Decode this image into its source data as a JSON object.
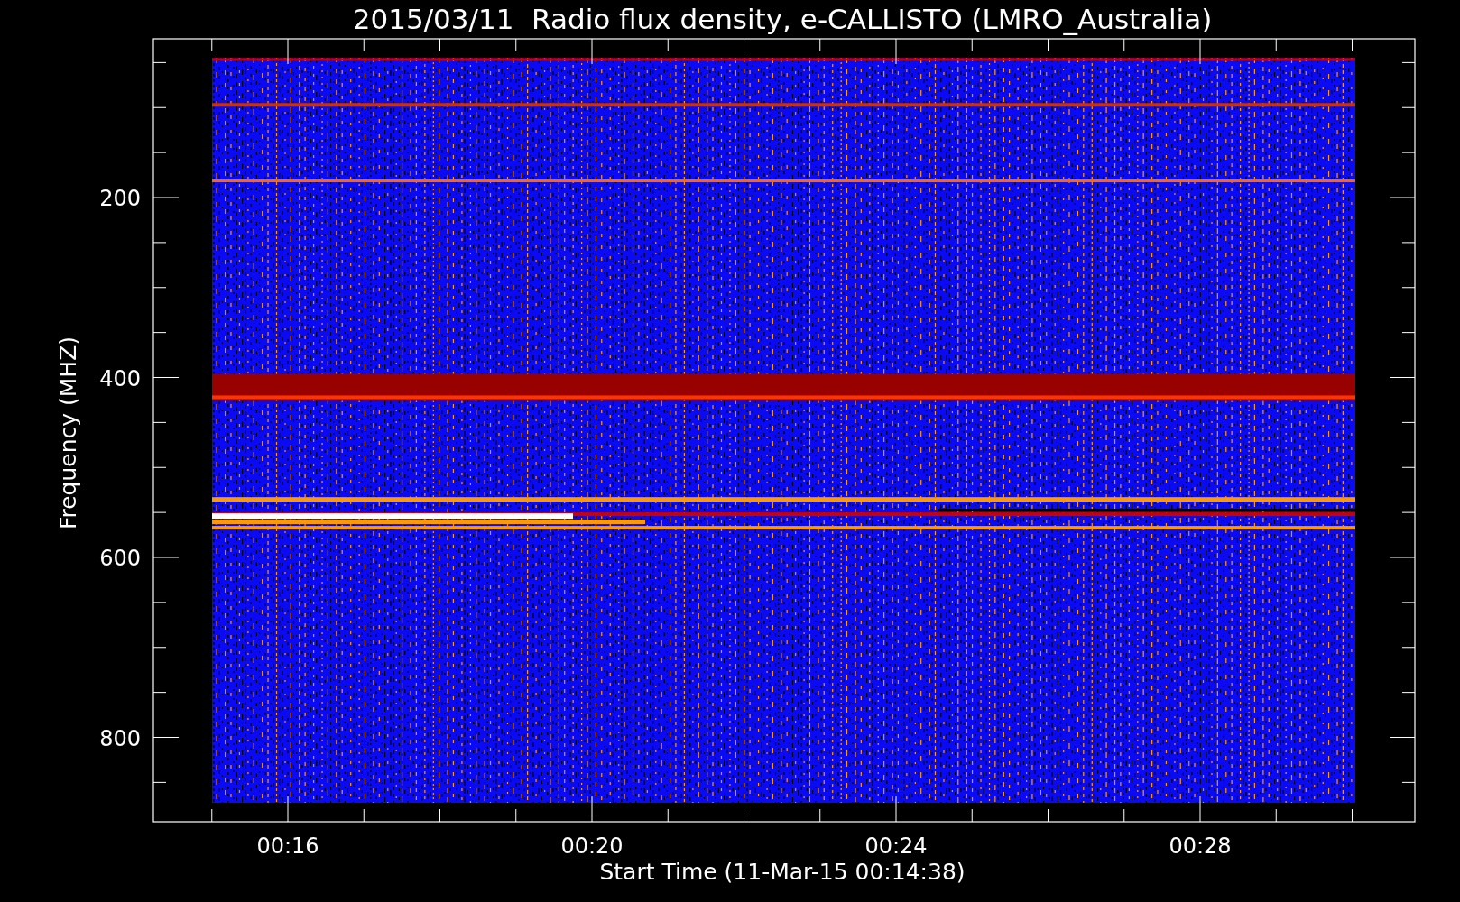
{
  "title": "2015/03/11  Radio flux density, e-CALLISTO (LMRO_Australia)",
  "y_axis": {
    "label": "Frequency (MHZ)",
    "ticks": [
      "200",
      "400",
      "600",
      "800"
    ]
  },
  "x_axis": {
    "label": "Start Time (11-Mar-15 00:14:38)",
    "ticks": [
      "00:16",
      "00:20",
      "00:24",
      "00:28"
    ]
  }
}
